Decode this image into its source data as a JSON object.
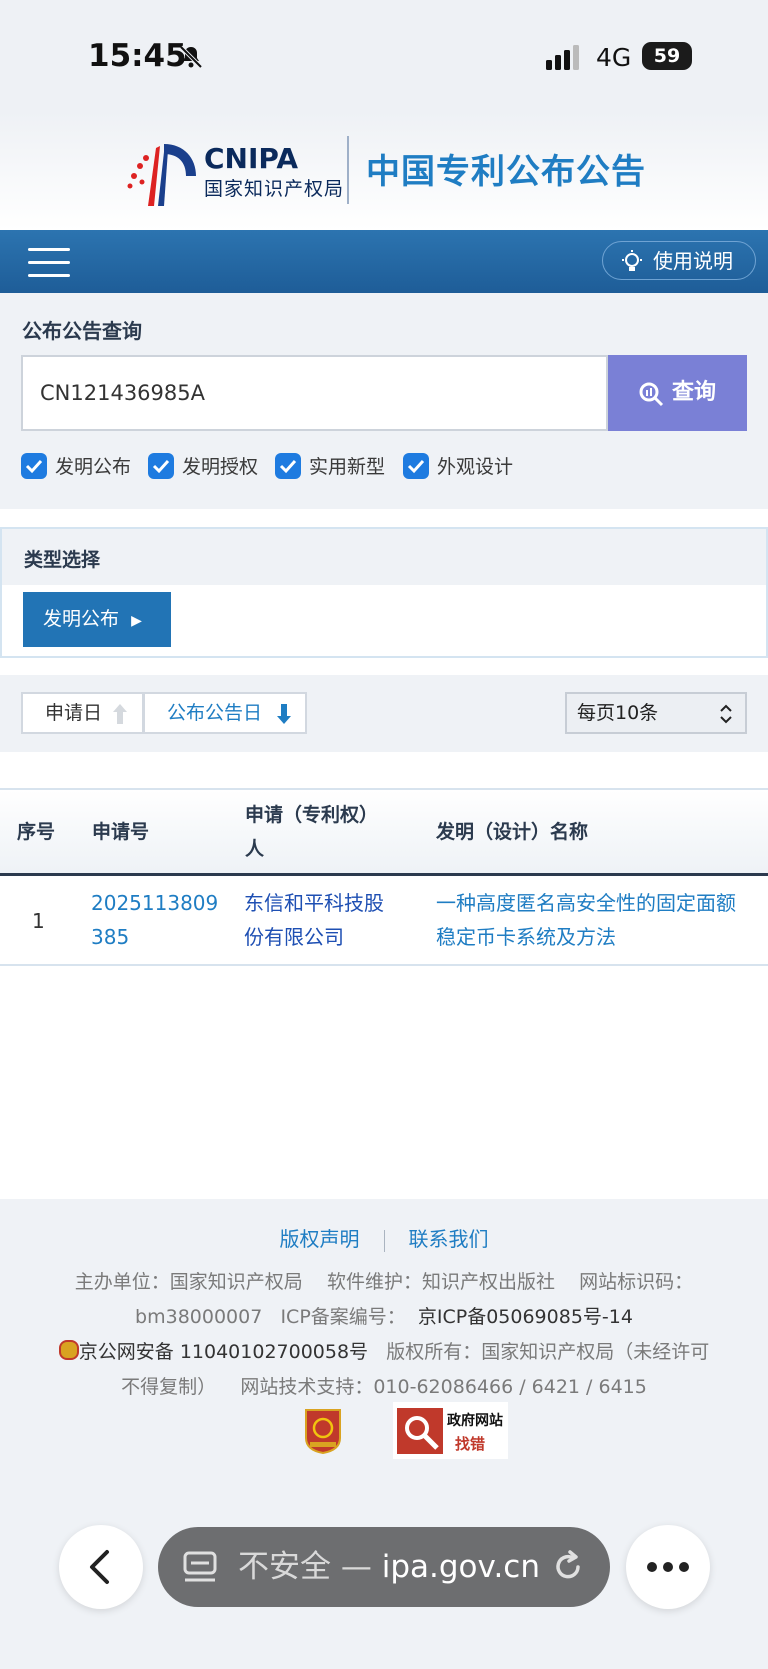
{
  "status_bar": {
    "time": "15:45",
    "network": "4G",
    "battery": "59"
  },
  "brand": {
    "logo_en": "CNIPA",
    "logo_cn": "国家知识产权局",
    "site_title": "中国专利公布公告"
  },
  "navbar": {
    "help_label": "使用说明"
  },
  "query": {
    "title": "公布公告查询",
    "input_value": "CN121436985A",
    "search_label": "查询",
    "checkboxes": [
      {
        "label": "发明公布",
        "checked": true
      },
      {
        "label": "发明授权",
        "checked": true
      },
      {
        "label": "实用新型",
        "checked": true
      },
      {
        "label": "外观设计",
        "checked": true
      }
    ]
  },
  "type_select": {
    "title": "类型选择",
    "selected_label": "发明公布"
  },
  "sort": {
    "apply_date": "申请日",
    "publish_date": "公布公告日",
    "page_size": "每页10条"
  },
  "table": {
    "headers": [
      "序号",
      "申请号",
      "申请（专利权）人",
      "发明（设计）名称"
    ],
    "rows": [
      {
        "index": "1",
        "app_no_line1": "2025113809",
        "app_no_line2": "385",
        "applicant_line1": "东信和平科技股",
        "applicant_line2": "份有限公司",
        "title_line1": "一种高度匿名高安全性的固定面额",
        "title_line2": "稳定币卡系统及方法"
      }
    ]
  },
  "footer": {
    "copyright_link": "版权声明",
    "contact_link": "联系我们",
    "host": "主办单位：国家知识产权局",
    "maintainer": "软件维护：知识产权出版社",
    "site_code_label": "网站标识码：",
    "site_code": "bm38000007",
    "icp_label": "ICP备案编号：",
    "icp_value": "京ICP备05069085号-14",
    "police": "京公网安备 11040102700058号",
    "rights_a": "版权所有：国家知识产权局（未经许可",
    "rights_b": "不得复制）",
    "support": "网站技术支持：010-62086466 / 6421 / 6415",
    "badge2_top": "政府网站",
    "badge2_bottom": "找错"
  },
  "browser": {
    "security": "不安全 —",
    "domain": "ipa.gov.cn"
  },
  "colors": {
    "nav_blue": "#1e5d98",
    "link_blue": "#1f7dc3",
    "search_button": "#7a80d6",
    "checkbox": "#1e7be0"
  }
}
